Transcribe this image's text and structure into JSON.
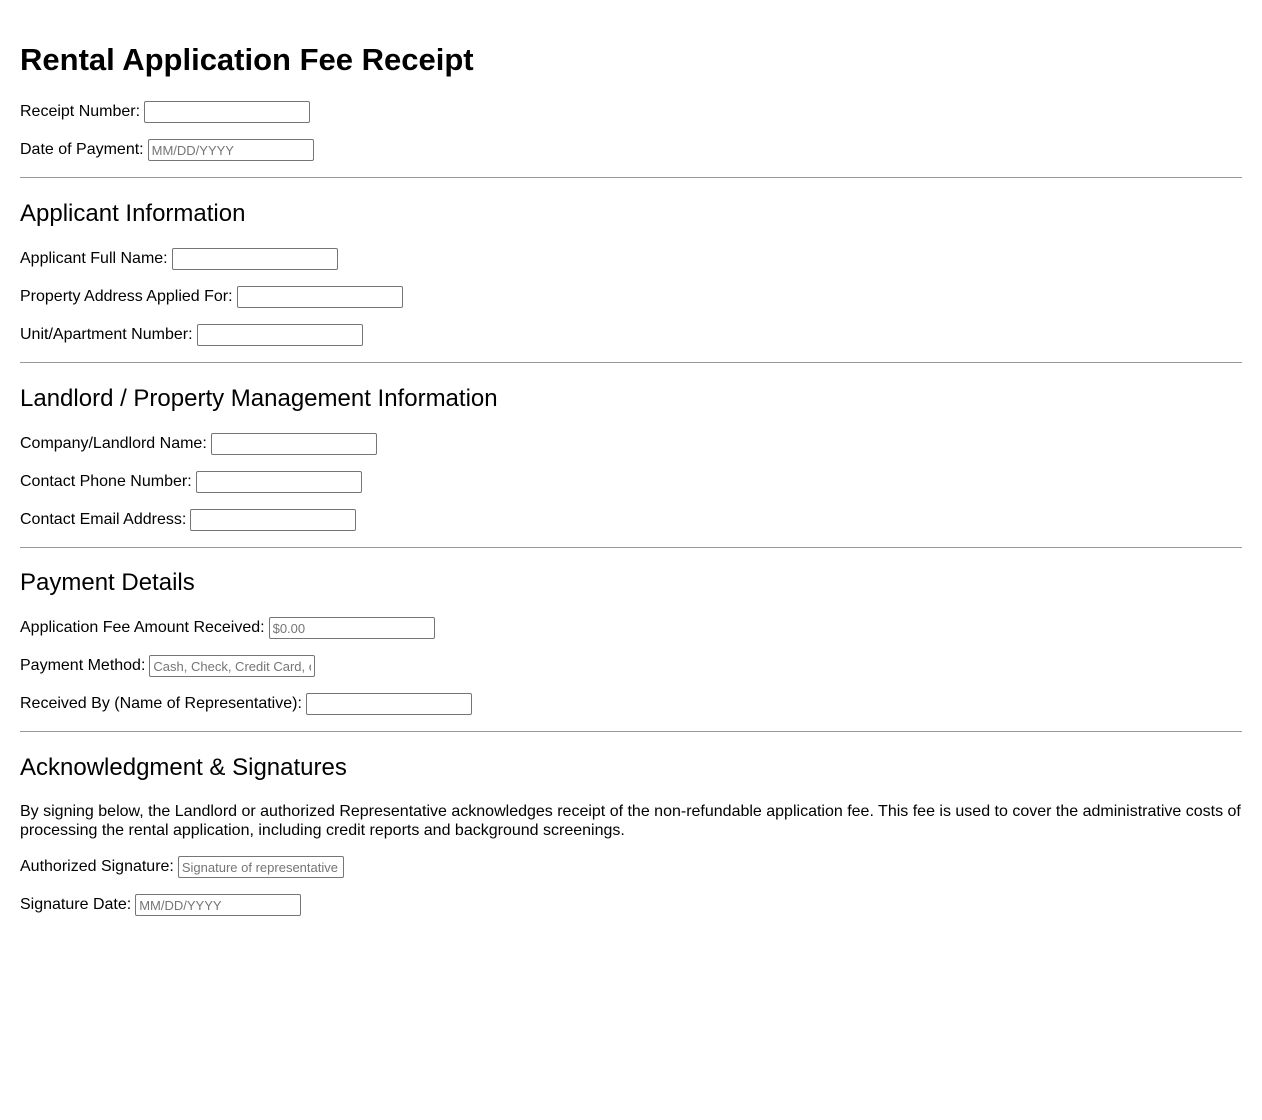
{
  "title": "Rental Application Fee Receipt",
  "header_fields": {
    "receipt_number": {
      "label": "Receipt Number:",
      "value": "",
      "placeholder": ""
    },
    "date_of_payment": {
      "label": "Date of Payment:",
      "value": "",
      "placeholder": "MM/DD/YYYY"
    }
  },
  "applicant": {
    "heading": "Applicant Information",
    "full_name": {
      "label": "Applicant Full Name:",
      "value": "",
      "placeholder": ""
    },
    "property_address": {
      "label": "Property Address Applied For:",
      "value": "",
      "placeholder": ""
    },
    "unit_number": {
      "label": "Unit/Apartment Number:",
      "value": "",
      "placeholder": ""
    }
  },
  "landlord": {
    "heading": "Landlord / Property Management Information",
    "company_name": {
      "label": "Company/Landlord Name:",
      "value": "",
      "placeholder": ""
    },
    "phone": {
      "label": "Contact Phone Number:",
      "value": "",
      "placeholder": ""
    },
    "email": {
      "label": "Contact Email Address:",
      "value": "",
      "placeholder": ""
    }
  },
  "payment": {
    "heading": "Payment Details",
    "fee_amount": {
      "label": "Application Fee Amount Received:",
      "value": "",
      "placeholder": "$0.00"
    },
    "method": {
      "label": "Payment Method:",
      "value": "",
      "placeholder": "Cash, Check, Credit Card, etc."
    },
    "received_by": {
      "label": "Received By (Name of Representative):",
      "value": "",
      "placeholder": ""
    }
  },
  "acknowledgment": {
    "heading": "Acknowledgment & Signatures",
    "text": "By signing below, the Landlord or authorized Representative acknowledges receipt of the non-refundable application fee. This fee is used to cover the administrative costs of processing the rental application, including credit reports and background screenings.",
    "signature": {
      "label": "Authorized Signature:",
      "value": "",
      "placeholder": "Signature of representative"
    },
    "signature_date": {
      "label": "Signature Date:",
      "value": "",
      "placeholder": "MM/DD/YYYY"
    }
  }
}
